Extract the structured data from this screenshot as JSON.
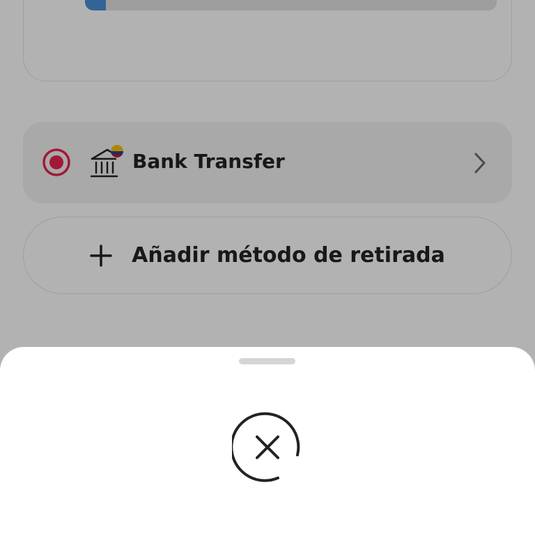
{
  "progress": {
    "fraction": 0.05,
    "fill_color": "#4a90d9"
  },
  "withdrawal_method": {
    "label": "Bank Transfer",
    "selected": true,
    "radio_color": "#e8254e",
    "icon": "bank-icon",
    "flag": "colombia-flag",
    "flag_colors": [
      "#f5c400",
      "#2a3f97",
      "#ce1126"
    ],
    "chevron_icon": "chevron-right-icon"
  },
  "add_method": {
    "label": "Añadir método de retirada",
    "icon": "plus-icon"
  },
  "sheet": {
    "icon": "close-circle-icon"
  }
}
